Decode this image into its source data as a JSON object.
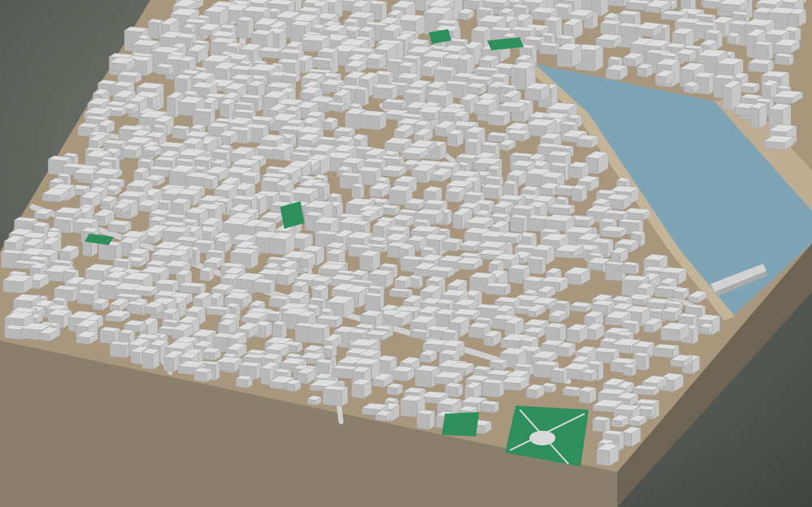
{
  "scene": {
    "type": "3d-city-block-model",
    "elements": [
      "buildings",
      "streets",
      "green-spaces",
      "river",
      "bridge",
      "terrain-base"
    ]
  },
  "colors": {
    "background": "#5f645d",
    "base_side_front": "#8a7f6b",
    "base_side_right": "#6d6454",
    "ground": "#a8977c",
    "building_top": "#dedede",
    "building_left": "#b8b8b8",
    "building_right": "#c7c7c7",
    "street": "#cfcfcf",
    "green": "#2e8f5c",
    "river": "#7ea4b6",
    "riverbank": "#bfae92"
  }
}
